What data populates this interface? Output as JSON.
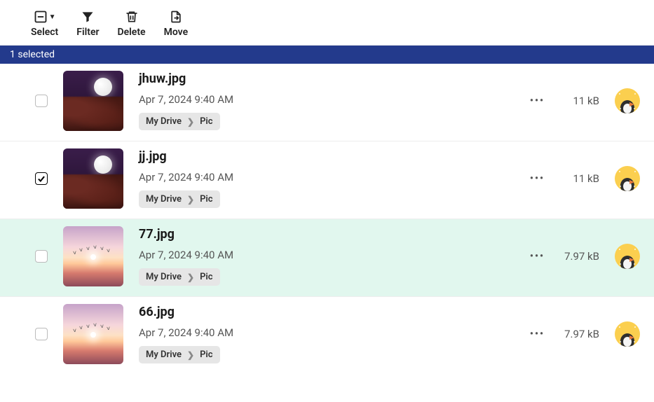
{
  "toolbar": {
    "select_label": "Select",
    "filter_label": "Filter",
    "delete_label": "Delete",
    "move_label": "Move"
  },
  "selection_bar": "1 selected",
  "breadcrumb": {
    "root": "My Drive",
    "leaf": "Pic"
  },
  "files": [
    {
      "name": "jhuw.jpg",
      "date": "Apr 7, 2024 9:40 AM",
      "size": "11 kB",
      "checked": false,
      "highlight": false,
      "thumb": "moon"
    },
    {
      "name": "jj.jpg",
      "date": "Apr 7, 2024 9:40 AM",
      "size": "11 kB",
      "checked": true,
      "highlight": false,
      "thumb": "moon"
    },
    {
      "name": "77.jpg",
      "date": "Apr 7, 2024 9:40 AM",
      "size": "7.97 kB",
      "checked": false,
      "highlight": true,
      "thumb": "sunset"
    },
    {
      "name": "66.jpg",
      "date": "Apr 7, 2024 9:40 AM",
      "size": "7.97 kB",
      "checked": false,
      "highlight": false,
      "thumb": "sunset"
    }
  ]
}
